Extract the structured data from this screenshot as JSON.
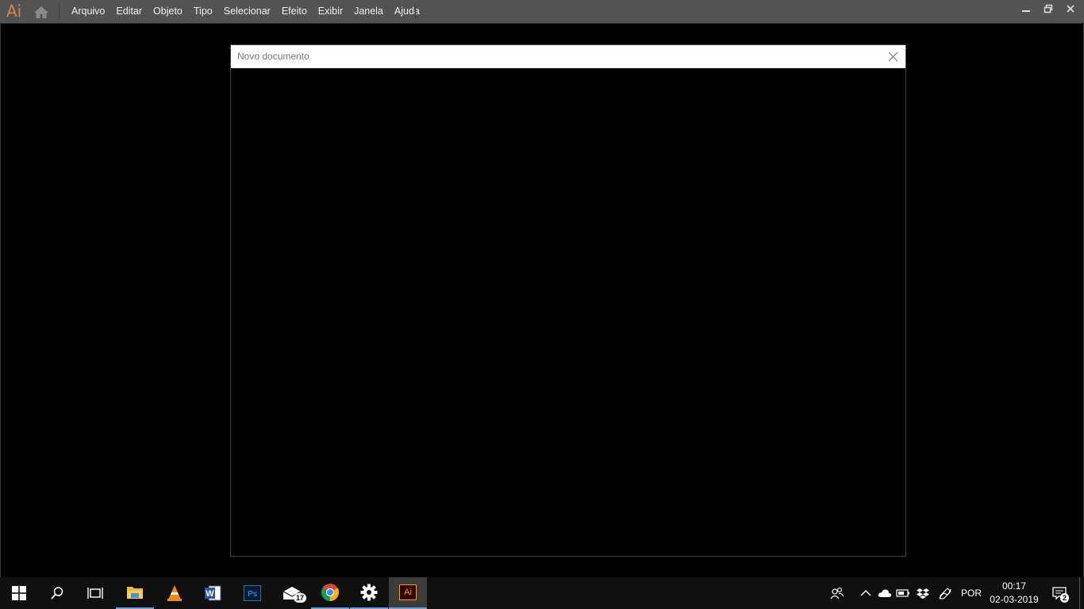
{
  "app": {
    "logo": "Ai"
  },
  "menu": [
    "Arquivo",
    "Editar",
    "Objeto",
    "Tipo",
    "Selecionar",
    "Efeito",
    "Exibir",
    "Janela",
    "Ajuda"
  ],
  "dialog": {
    "title": "Novo documento"
  },
  "taskbar": {
    "apps": [
      {
        "name": "file-explorer",
        "running": true
      },
      {
        "name": "vlc",
        "running": false
      },
      {
        "name": "word",
        "running": false
      },
      {
        "name": "photoshop",
        "running": false
      },
      {
        "name": "mail",
        "running": false,
        "badge": "17"
      },
      {
        "name": "chrome",
        "running": true
      },
      {
        "name": "settings",
        "running": true
      },
      {
        "name": "illustrator",
        "running": true,
        "active": true,
        "label": "Ai"
      }
    ],
    "language": "POR",
    "time": "00:17",
    "date": "02-03-2019",
    "notification_count": "2"
  },
  "colors": {
    "illustrator_brand": "#ff9a00",
    "accent": "#6a9fd4",
    "menubar": "#535353"
  }
}
